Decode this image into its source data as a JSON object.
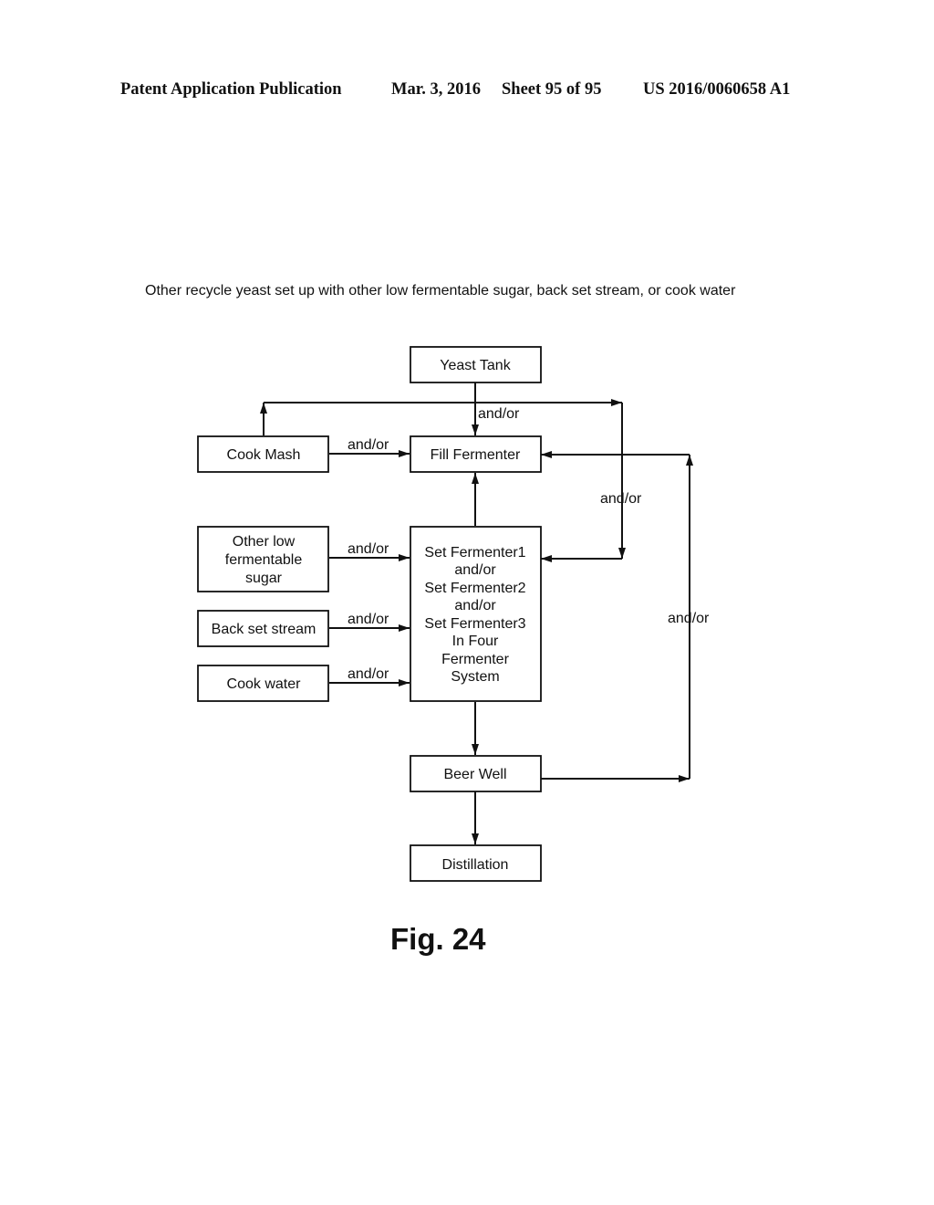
{
  "header": {
    "publication": "Patent Application Publication",
    "date": "Mar. 3, 2016",
    "sheet": "Sheet 95 of 95",
    "number": "US 2016/0060658 A1"
  },
  "subtitle": "Other recycle yeast set up with other low fermentable sugar, back set stream, or cook water",
  "diagram": {
    "nodes": {
      "yeast_tank": [
        "Yeast Tank"
      ],
      "cook_mash": [
        "Cook Mash"
      ],
      "fill_fermenter": [
        "Fill Fermenter"
      ],
      "other_sugar": [
        "Other low",
        "fermentable",
        "sugar"
      ],
      "back_set": [
        "Back set stream"
      ],
      "cook_water": [
        "Cook water"
      ],
      "set_fermenter": [
        "Set Fermenter1",
        "and/or",
        "Set Fermenter2",
        "and/or",
        "Set Fermenter3",
        "In Four",
        "Fermenter",
        "System"
      ],
      "beer_well": [
        "Beer Well"
      ],
      "distillation": [
        "Distillation"
      ]
    },
    "edge_labels": {
      "yeast_to_fill": "and/or",
      "cookmash_to_fill": "and/or",
      "recycle_right": "and/or",
      "sugar_to_set": "and/or",
      "backset_to_set": "and/or",
      "cookwater_to_set": "and/or",
      "beerwell_loop": "and/or"
    }
  },
  "figure_label": "Fig. 24"
}
